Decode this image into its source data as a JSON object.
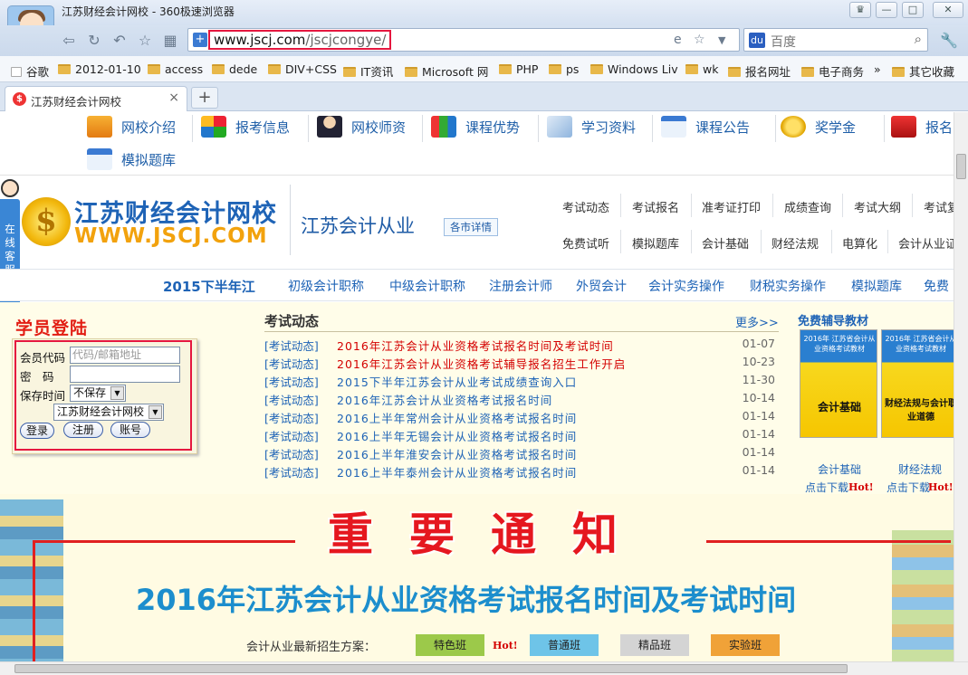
{
  "browser": {
    "window_title": "江苏财经会计网校 - 360极速浏览器",
    "url_host": "www.jscj.com",
    "url_path": "/jscjcongye/",
    "search_placeholder": "百度",
    "tab_title": "江苏财经会计网校",
    "newtab": "+",
    "bookmarks": [
      "谷歌",
      "2012-01-10",
      "access",
      "dede",
      "DIV+CSS",
      "IT资讯",
      "Microsoft 网",
      "PHP",
      "ps",
      "Windows Liv",
      "wk",
      "报名网址",
      "电子商务"
    ],
    "bookmarks_more": "»",
    "bookmarks_other": "其它收藏"
  },
  "topnav": {
    "row1": [
      "网校介绍",
      "报考信息",
      "网校师资",
      "课程优势",
      "学习资料",
      "课程公告",
      "奖学金",
      "报名"
    ],
    "row2": [
      "模拟题库"
    ]
  },
  "header": {
    "logo_cn": "江苏财经会计网校",
    "logo_en": "WWW.JSCJ.COM",
    "section_title": "江苏会计从业",
    "city_button": "各市详情",
    "links_row1": [
      "考试动态",
      "考试报名",
      "准考证打印",
      "成绩查询",
      "考试大纲",
      "考试复"
    ],
    "links_row2": [
      "免费试听",
      "模拟题库",
      "会计基础",
      "财经法规",
      "电算化",
      "会计从业证"
    ],
    "kefu": "在线客服"
  },
  "subnav": {
    "lead": "2015下半年江",
    "items": [
      "初级会计职称",
      "中级会计职称",
      "注册会计师",
      "外贸会计",
      "会计实务操作",
      "财税实务操作",
      "模拟题库",
      "免费"
    ]
  },
  "login": {
    "title": "学员登陆",
    "code_label": "会员代码",
    "code_placeholder": "代码/邮箱地址",
    "pwd_label": "密　码",
    "keep_label": "保存时间",
    "keep_value": "不保存",
    "school_value": "江苏财经会计网校",
    "btn_login": "登录",
    "btn_register": "注册",
    "btn_account": "账号"
  },
  "news": {
    "title": "考试动态",
    "more": "更多>>",
    "items": [
      {
        "cat": "[考试动态]",
        "title": "2016年江苏会计从业资格考试报名时间及考试时间",
        "date": "01-07",
        "hot": true
      },
      {
        "cat": "[考试动态]",
        "title": "2016年江苏会计从业资格考试辅导报名招生工作开启",
        "date": "10-23",
        "hot": true
      },
      {
        "cat": "[考试动态]",
        "title": "2015下半年江苏会计从业考试成绩查询入口",
        "date": "11-30",
        "hot": false
      },
      {
        "cat": "[考试动态]",
        "title": "2016年江苏会计从业资格考试报名时间",
        "date": "10-14",
        "hot": false
      },
      {
        "cat": "[考试动态]",
        "title": "2016上半年常州会计从业资格考试报名时间",
        "date": "01-14",
        "hot": false
      },
      {
        "cat": "[考试动态]",
        "title": "2016上半年无锡会计从业资格考试报名时间",
        "date": "01-14",
        "hot": false
      },
      {
        "cat": "[考试动态]",
        "title": "2016上半年淮安会计从业资格考试报名时间",
        "date": "01-14",
        "hot": false
      },
      {
        "cat": "[考试动态]",
        "title": "2016上半年泰州会计从业资格考试报名时间",
        "date": "01-14",
        "hot": false
      }
    ]
  },
  "materials": {
    "title": "免费辅导教材",
    "books": [
      {
        "top": "2016年 江苏省会计从业资格考试教材",
        "name": "会计基础",
        "caption": "会计基础",
        "dl": "点击下载",
        "hot": "Hot!"
      },
      {
        "top": "2016年 江苏省会计从业资格考试教材",
        "name": "财经法规与会计职业道德",
        "caption": "财经法规",
        "dl": "点击下载",
        "hot": "Hot!"
      }
    ]
  },
  "banner": {
    "title": "重要通知",
    "subtitle": "2016年江苏会计从业资格考试报名时间及考试时间",
    "plan_label": "会计从业最新招生方案：",
    "hot": "Hot!",
    "plans": [
      {
        "label": "特色班",
        "color": "#9cc94a"
      },
      {
        "label": "普通班",
        "color": "#6ec4e8"
      },
      {
        "label": "精品班",
        "color": "#d4d4d4"
      },
      {
        "label": "实验班",
        "color": "#f0a238"
      }
    ]
  }
}
